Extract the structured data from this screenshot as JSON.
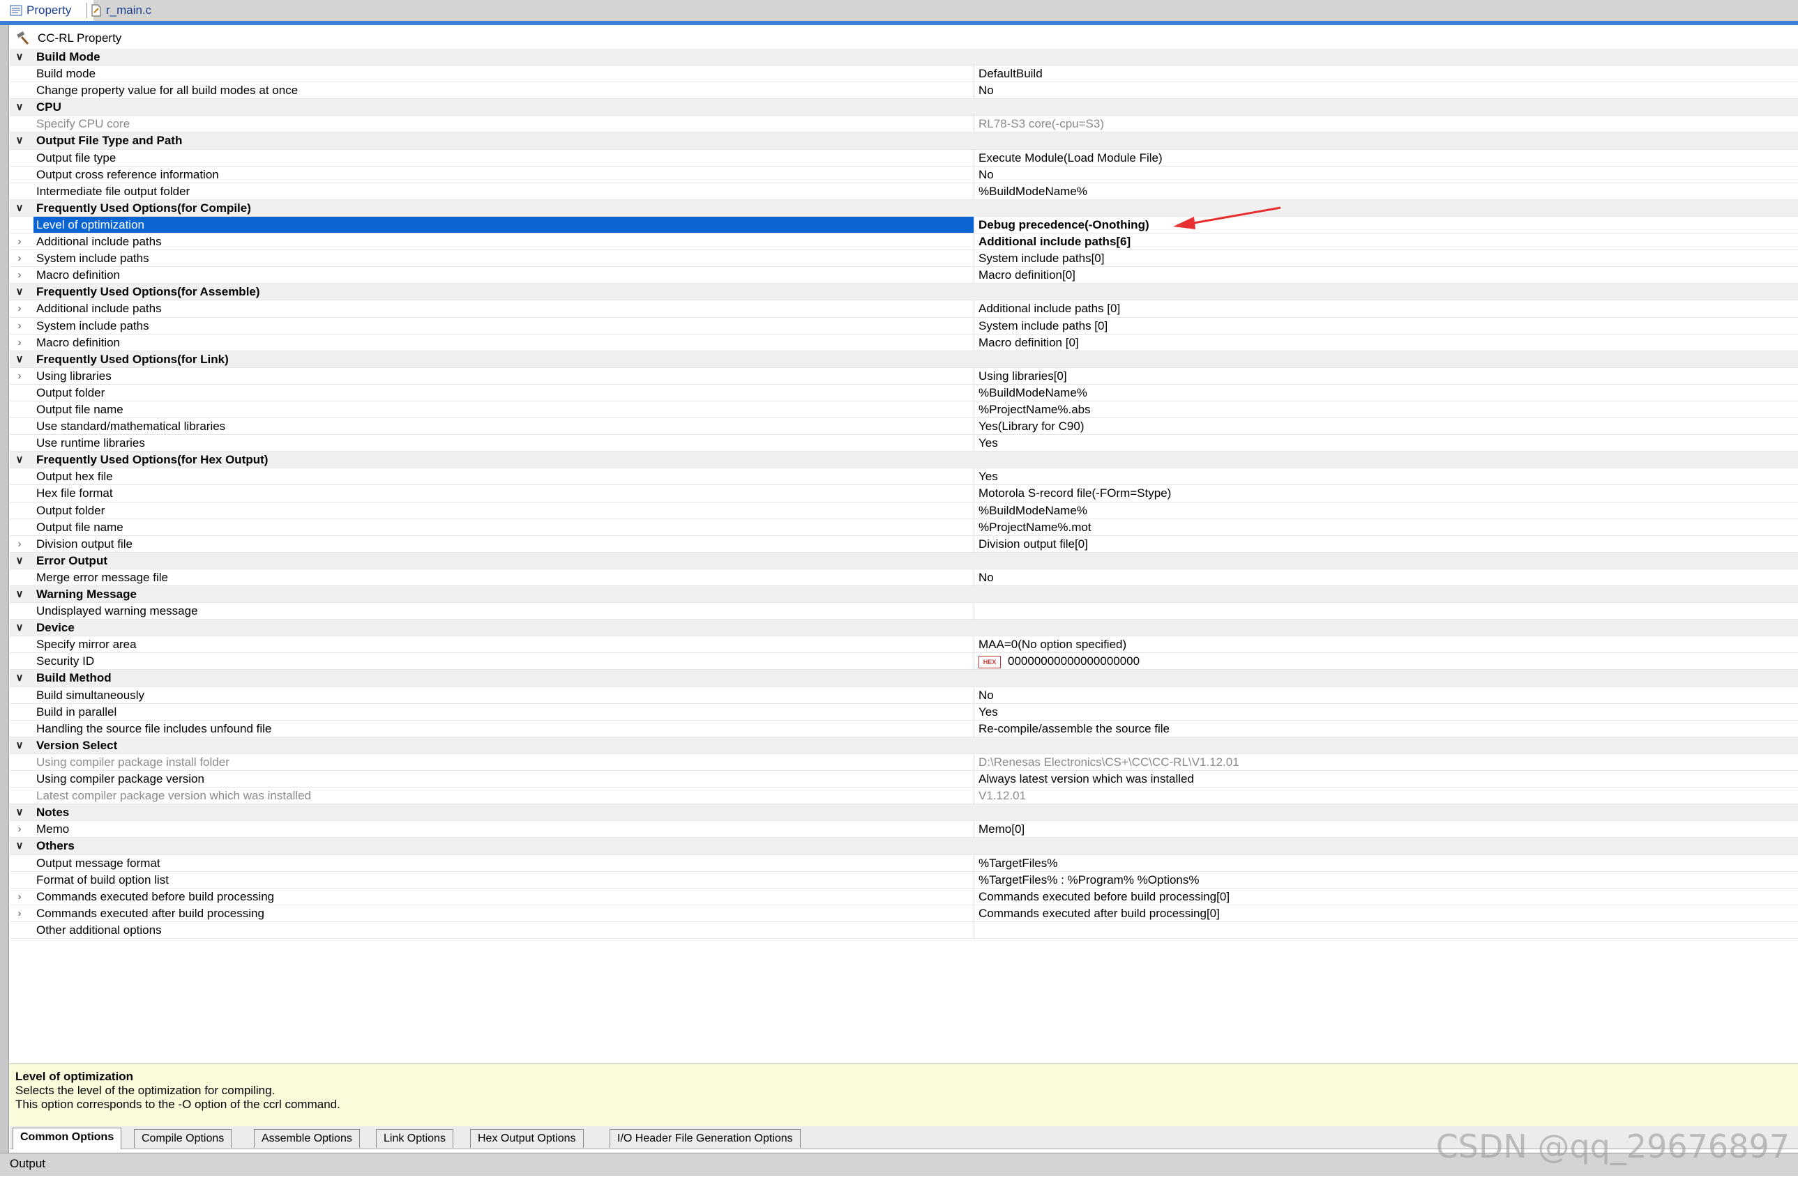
{
  "tabs": [
    {
      "label": "Property",
      "icon": "property-icon"
    },
    {
      "label": "r_main.c",
      "icon": "file-icon"
    }
  ],
  "header": {
    "title": "CC-RL Property",
    "icon": "hammer-icon"
  },
  "rows": [
    {
      "type": "cat",
      "arrow": "∨",
      "name": "Build Mode"
    },
    {
      "type": "prop",
      "name": "Build mode",
      "value": "DefaultBuild"
    },
    {
      "type": "prop",
      "name": "Change property value for all build modes at once",
      "value": "No"
    },
    {
      "type": "cat",
      "arrow": "∨",
      "name": "CPU"
    },
    {
      "type": "prop",
      "dis": true,
      "name": "Specify CPU core",
      "value": "RL78-S3 core(-cpu=S3)"
    },
    {
      "type": "cat",
      "arrow": "∨",
      "name": "Output File Type and Path"
    },
    {
      "type": "prop",
      "name": "Output file type",
      "value": "Execute Module(Load Module File)"
    },
    {
      "type": "prop",
      "name": "Output cross reference information",
      "value": "No"
    },
    {
      "type": "prop",
      "name": "Intermediate file output folder",
      "value": "%BuildModeName%"
    },
    {
      "type": "cat",
      "arrow": "∨",
      "name": "Frequently Used Options(for Compile)"
    },
    {
      "type": "prop",
      "sel": true,
      "bold": true,
      "name": "Level of optimization",
      "value": "Debug precedence(-Onothing)"
    },
    {
      "type": "prop",
      "arrow": "›",
      "bold": true,
      "name": "Additional include paths",
      "value": "Additional include paths[6]"
    },
    {
      "type": "prop",
      "arrow": "›",
      "name": "System include paths",
      "value": "System include paths[0]"
    },
    {
      "type": "prop",
      "arrow": "›",
      "name": "Macro definition",
      "value": "Macro definition[0]"
    },
    {
      "type": "cat",
      "arrow": "∨",
      "name": "Frequently Used Options(for Assemble)"
    },
    {
      "type": "prop",
      "arrow": "›",
      "name": "Additional include paths",
      "value": "Additional include paths [0]"
    },
    {
      "type": "prop",
      "arrow": "›",
      "name": "System include paths",
      "value": "System include paths [0]"
    },
    {
      "type": "prop",
      "arrow": "›",
      "name": "Macro definition",
      "value": "Macro definition [0]"
    },
    {
      "type": "cat",
      "arrow": "∨",
      "name": "Frequently Used Options(for Link)"
    },
    {
      "type": "prop",
      "arrow": "›",
      "name": "Using libraries",
      "value": "Using libraries[0]"
    },
    {
      "type": "prop",
      "name": "Output folder",
      "value": "%BuildModeName%"
    },
    {
      "type": "prop",
      "name": "Output file name",
      "value": "%ProjectName%.abs"
    },
    {
      "type": "prop",
      "name": "Use standard/mathematical libraries",
      "value": "Yes(Library for C90)"
    },
    {
      "type": "prop",
      "name": "Use runtime libraries",
      "value": "Yes"
    },
    {
      "type": "cat",
      "arrow": "∨",
      "name": "Frequently Used Options(for Hex Output)"
    },
    {
      "type": "prop",
      "name": "Output hex file",
      "value": "Yes"
    },
    {
      "type": "prop",
      "name": "Hex file format",
      "value": "Motorola S-record file(-FOrm=Stype)"
    },
    {
      "type": "prop",
      "name": "Output folder",
      "value": "%BuildModeName%"
    },
    {
      "type": "prop",
      "name": "Output file name",
      "value": "%ProjectName%.mot"
    },
    {
      "type": "prop",
      "arrow": "›",
      "name": "Division output file",
      "value": "Division output file[0]"
    },
    {
      "type": "cat",
      "arrow": "∨",
      "name": "Error Output"
    },
    {
      "type": "prop",
      "name": "Merge error message file",
      "value": "No"
    },
    {
      "type": "cat",
      "arrow": "∨",
      "name": "Warning Message"
    },
    {
      "type": "prop",
      "name": "Undisplayed warning message",
      "value": ""
    },
    {
      "type": "cat",
      "arrow": "∨",
      "name": "Device"
    },
    {
      "type": "prop",
      "name": "Specify mirror area",
      "value": "MAA=0(No option specified)"
    },
    {
      "type": "prop",
      "hex": true,
      "name": "Security ID",
      "value": "00000000000000000000"
    },
    {
      "type": "cat",
      "arrow": "∨",
      "name": "Build Method"
    },
    {
      "type": "prop",
      "name": "Build simultaneously",
      "value": "No"
    },
    {
      "type": "prop",
      "name": "Build in parallel",
      "value": "Yes"
    },
    {
      "type": "prop",
      "name": "Handling the source file includes unfound file",
      "value": "Re-compile/assemble the source file"
    },
    {
      "type": "cat",
      "arrow": "∨",
      "name": "Version Select"
    },
    {
      "type": "prop",
      "dis": true,
      "name": "Using compiler package install folder",
      "value": "D:\\Renesas Electronics\\CS+\\CC\\CC-RL\\V1.12.01"
    },
    {
      "type": "prop",
      "name": "Using compiler package version",
      "value": "Always latest version which was installed"
    },
    {
      "type": "prop",
      "dis": true,
      "name": "Latest compiler package version which was installed",
      "value": "V1.12.01"
    },
    {
      "type": "cat",
      "arrow": "∨",
      "name": "Notes"
    },
    {
      "type": "prop",
      "arrow": "›",
      "name": "Memo",
      "value": "Memo[0]"
    },
    {
      "type": "cat",
      "arrow": "∨",
      "name": "Others"
    },
    {
      "type": "prop",
      "name": "Output message format",
      "value": "%TargetFiles%"
    },
    {
      "type": "prop",
      "name": "Format of build option list",
      "value": "%TargetFiles% : %Program% %Options%"
    },
    {
      "type": "prop",
      "arrow": "›",
      "name": "Commands executed before build processing",
      "value": "Commands executed before build processing[0]"
    },
    {
      "type": "prop",
      "arrow": "›",
      "name": "Commands executed after build processing",
      "value": "Commands executed after build processing[0]"
    },
    {
      "type": "prop",
      "name": "Other additional options",
      "value": ""
    }
  ],
  "hex_badge": "HEX",
  "description": {
    "title": "Level of optimization",
    "line1": "Selects the level of the optimization for compiling.",
    "line2": "This option corresponds to the -O option of the ccrl command."
  },
  "bottom_tabs": [
    "Common Options",
    "Compile Options",
    "Assemble Options",
    "Link Options",
    "Hex Output Options",
    "I/O Header File Generation Options"
  ],
  "output": {
    "label": "Output"
  },
  "watermark": "CSDN @qq_29676897",
  "colors": {
    "selection": "#0a64d4",
    "accent_line": "#3a7fd5",
    "description_bg": "#fbfbdb",
    "annotation_arrow": "#e83030"
  }
}
